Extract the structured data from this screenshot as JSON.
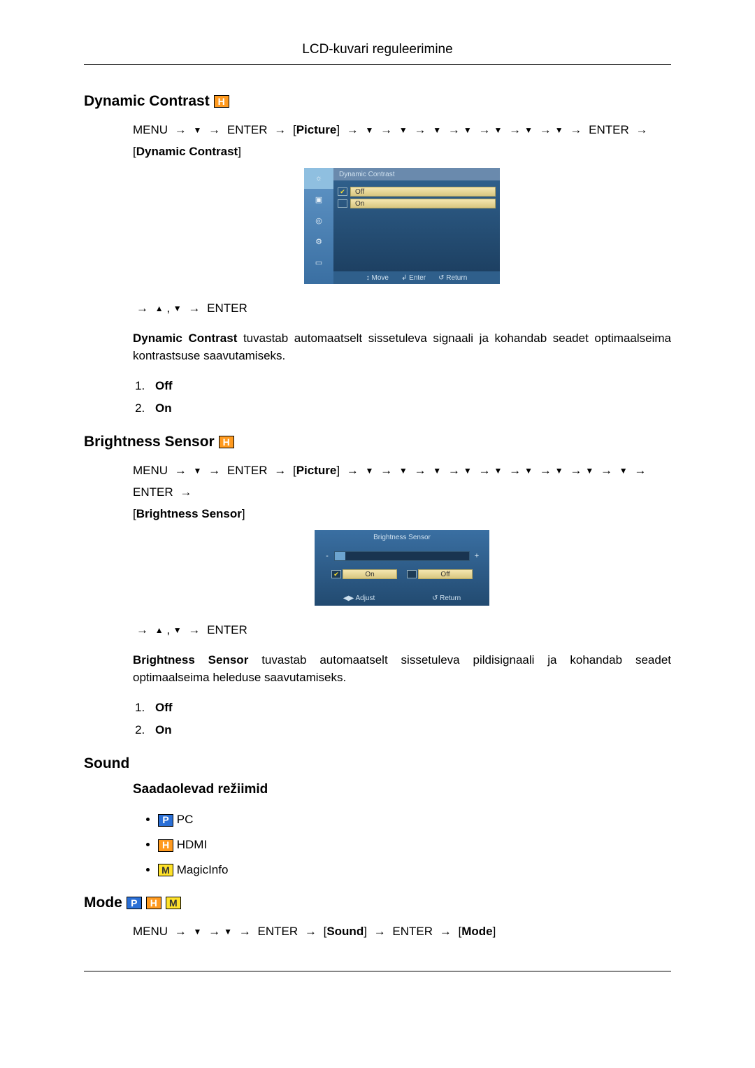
{
  "header": {
    "title": "LCD-kuvari reguleerimine"
  },
  "sections": {
    "dynamic_contrast": {
      "title": "Dynamic Contrast",
      "nav_prefix": "MENU",
      "enter": "ENTER",
      "picture": "Picture",
      "bracket_label": "Dynamic Contrast",
      "osd": {
        "title": "Dynamic Contrast",
        "options": [
          "Off",
          "On"
        ],
        "selected_index": 0,
        "footer": {
          "move": "Move",
          "enter": "Enter",
          "return": "Return"
        }
      },
      "after_nav": "ENTER",
      "body_lead": "Dynamic Contrast",
      "body_rest": " tuvastab automaatselt sissetuleva signaali ja kohandab seadet optimaalseima kontrastsuse saavutamiseks.",
      "list": [
        "Off",
        "On"
      ]
    },
    "brightness_sensor": {
      "title": "Brightness Sensor",
      "nav_prefix": "MENU",
      "enter": "ENTER",
      "picture": "Picture",
      "bracket_label": "Brightness Sensor",
      "osd": {
        "title": "Brightness Sensor",
        "on": "On",
        "off": "Off",
        "selected": "On",
        "footer": {
          "adjust": "Adjust",
          "return": "Return"
        }
      },
      "after_nav": "ENTER",
      "body_lead": "Brightness Sensor",
      "body_rest": " tuvastab automaatselt sissetuleva pildisignaali ja kohandab seadet optimaalseima heleduse saavutamiseks.",
      "list": [
        "Off",
        "On"
      ]
    },
    "sound": {
      "title": "Sound",
      "modes_title": "Saadaolevad režiimid",
      "modes": [
        {
          "badge": "P",
          "label": "PC"
        },
        {
          "badge": "H",
          "label": "HDMI"
        },
        {
          "badge": "M",
          "label": "MagicInfo"
        }
      ]
    },
    "mode": {
      "title": "Mode",
      "nav": {
        "menu": "MENU",
        "enter": "ENTER",
        "sound": "Sound",
        "mode": "Mode"
      }
    }
  },
  "icons": {
    "arrow": "→",
    "down": "▼",
    "up": "▲",
    "updown": "↕",
    "enter_icon": "↲",
    "return_icon": "↺",
    "leftright": "◀▶",
    "check": "✔"
  }
}
